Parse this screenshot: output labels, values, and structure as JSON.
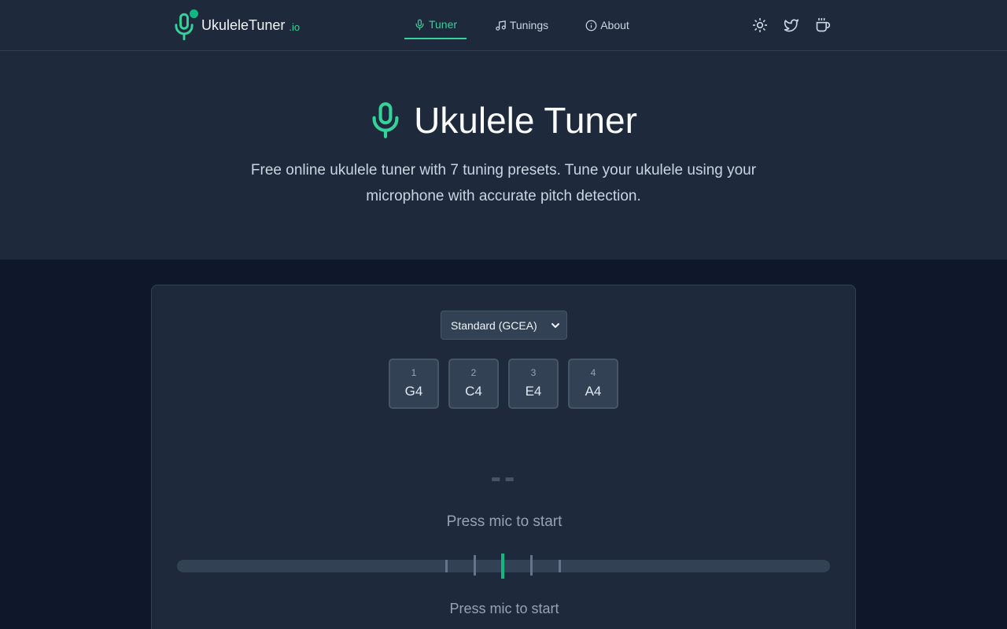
{
  "brand": {
    "name": "UkuleleTuner",
    "suffix": ".io"
  },
  "nav": [
    {
      "label": "Tuner",
      "icon": "mic-icon",
      "active": true
    },
    {
      "label": "Tunings",
      "icon": "music-note-icon",
      "active": false
    },
    {
      "label": "About",
      "icon": "info-icon",
      "active": false
    }
  ],
  "header_actions": [
    "sun-icon",
    "twitter-icon",
    "coffee-cup-icon"
  ],
  "hero": {
    "title": "Ukulele Tuner",
    "description": "Free online ukulele tuner with 7 tuning presets. Tune your ukulele using your microphone with accurate pitch detection."
  },
  "tuner": {
    "tuning_selected": "Standard (GCEA)",
    "strings": [
      {
        "number": "1",
        "note": "G4"
      },
      {
        "number": "2",
        "note": "C4"
      },
      {
        "number": "3",
        "note": "E4"
      },
      {
        "number": "4",
        "note": "A4"
      }
    ],
    "note_display": "--",
    "status_top": "Press mic to start",
    "status_bottom": "Press mic to start",
    "needle_cents": 0
  },
  "colors": {
    "accent": "#10b981",
    "background": "#0f172a",
    "panel": "#1e293b"
  }
}
